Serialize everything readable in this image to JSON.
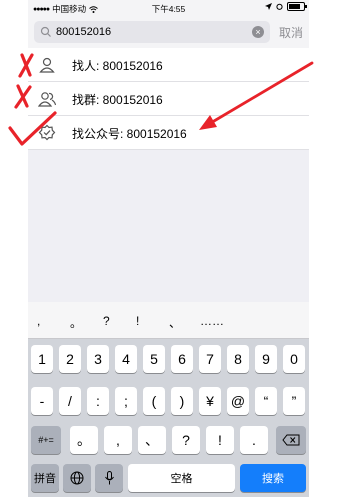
{
  "status_bar": {
    "carrier": "中国移动",
    "time": "下午4:55",
    "battery_level": 0.8
  },
  "search": {
    "value": "800152016",
    "cancel_label": "取消"
  },
  "results": [
    {
      "label": "找人: 800152016",
      "icon": "person-icon"
    },
    {
      "label": "找群: 800152016",
      "icon": "group-icon"
    },
    {
      "label": "找公众号: 800152016",
      "icon": "official-account-icon"
    }
  ],
  "keyboard": {
    "suggestions": [
      ",",
      "。",
      "?",
      "!",
      "、",
      "……"
    ],
    "row1": [
      "1",
      "2",
      "3",
      "4",
      "5",
      "6",
      "7",
      "8",
      "9",
      "0"
    ],
    "row2": [
      "-",
      "/",
      ":",
      ";",
      "(",
      ")",
      "¥",
      "@",
      "“",
      "”"
    ],
    "row3_toggle": "#+=",
    "row3": [
      "。",
      ",",
      "、",
      "?",
      "!",
      "."
    ],
    "pinyin_label": "拼音",
    "space_label": "空格",
    "search_label": "搜索"
  },
  "colors": {
    "accent": "#147efb",
    "annotation": "#e8232a"
  }
}
